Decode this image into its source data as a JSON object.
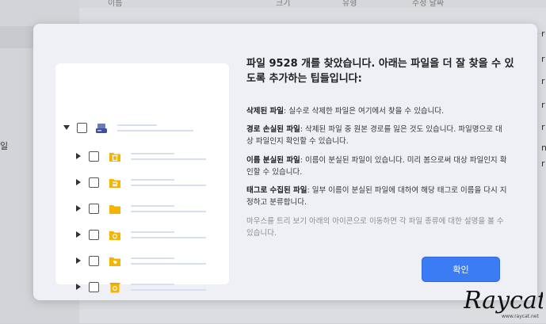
{
  "background": {
    "columns": [
      "이름",
      "크기",
      "유형",
      "수정 날짜"
    ],
    "sidebar_text": "일",
    "right_letters": [
      "r",
      "r",
      "r",
      "r",
      "r",
      "n",
      "r"
    ]
  },
  "dialog": {
    "title": "파일 9528 개를 찾았습니다. 아래는 파일을 더 잘 찾을 수 있도록 추가하는 팁들입니다:",
    "tips": [
      {
        "term": "삭제된 파일",
        "text": ": 실수로 삭제한 파일은 여기에서 찾을 수 있습니다."
      },
      {
        "term": "경로 손실된 파일",
        "text": ": 삭제된 파일 중 원본 경로를 잃은 것도 있습니다. 파일명으로 대상 파일인지 확인할 수 있습니다."
      },
      {
        "term": "이름 분실된 파일",
        "text": ": 이름이 분실된 파일이 있습니다. 미리 봄으로써 대상 파일인지 확인할 수 있습니다."
      },
      {
        "term": "태그로 수집된 파일",
        "text": ": 일부 이름이 분실된 파일에 대하여 해당 태그로 이름을 다시 지정하고 분류합니다."
      }
    ],
    "hint": "마우스를 트리 보기 아래의 아이콘으로 이동하면 각 파일 종류에 대한 설명을 볼 수 있습니다.",
    "confirm_label": "확인"
  },
  "watermark": {
    "brand": "Raycat",
    "url": "www.raycat.net"
  },
  "colors": {
    "accent": "#3b7bf3",
    "folder": "#f5b400",
    "tree_line": "#d6def0"
  },
  "tree_icons": [
    "drive-icon",
    "trash-folder-icon",
    "path-lost-folder-icon",
    "folder-icon",
    "name-lost-folder-icon",
    "tag-folder-icon",
    "recycle-bin-icon"
  ]
}
